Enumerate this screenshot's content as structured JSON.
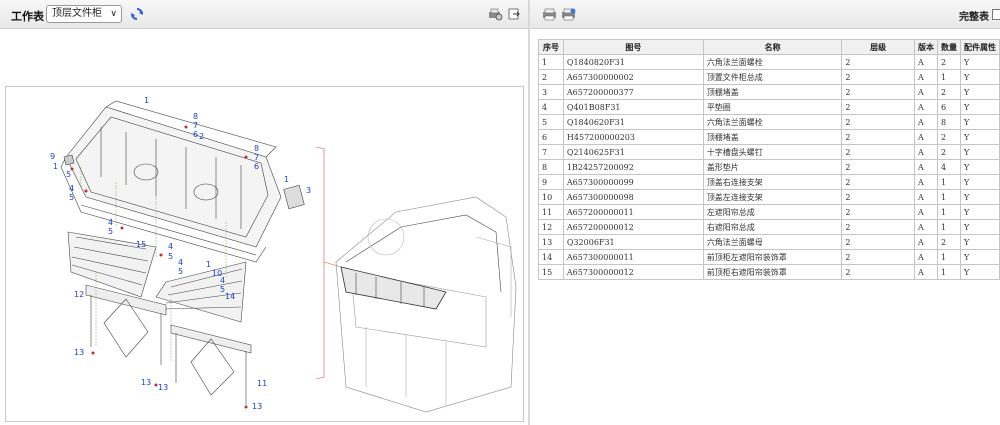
{
  "toolbar_left": {
    "title": "工作表",
    "select_value": "顶层文件柜",
    "icons": [
      "dropdown-chevron",
      "refresh-icon",
      "print-preview-icon",
      "export-icon"
    ]
  },
  "toolbar_right": {
    "complete_label": "完整表",
    "icons": [
      "print-icon",
      "print-all-icon"
    ],
    "complete_checked": false
  },
  "drawing": {
    "callouts": [
      "1",
      "8",
      "7",
      "6",
      "2",
      "9",
      "1",
      "5",
      "4",
      "5",
      "8",
      "7",
      "6",
      "1",
      "3",
      "4",
      "5",
      "4",
      "5",
      "15",
      "4",
      "5",
      "4",
      "5",
      "1",
      "10",
      "4",
      "5",
      "5",
      "12",
      "14",
      "13",
      "13",
      "13",
      "11",
      "13"
    ]
  },
  "table": {
    "headers": [
      "序号",
      "图号",
      "名称",
      "层级",
      "版本",
      "数量",
      "配件属性"
    ],
    "rows": [
      [
        "1",
        "Q1840820F31",
        "六角法兰面螺栓",
        "2",
        "A",
        "2",
        "Y"
      ],
      [
        "2",
        "A657300000002",
        "顶置文件柜总成",
        "2",
        "A",
        "1",
        "Y"
      ],
      [
        "3",
        "A657200000377",
        "顶棚堵盖",
        "2",
        "A",
        "2",
        "Y"
      ],
      [
        "4",
        "Q401B08F31",
        "平垫圈",
        "2",
        "A",
        "6",
        "Y"
      ],
      [
        "5",
        "Q1840620F31",
        "六角法兰面螺栓",
        "2",
        "A",
        "8",
        "Y"
      ],
      [
        "6",
        "H457200000203",
        "顶棚堵盖",
        "2",
        "A",
        "2",
        "Y"
      ],
      [
        "7",
        "Q2140625F31",
        "十字槽盘头螺钉",
        "2",
        "A",
        "2",
        "Y"
      ],
      [
        "8",
        "1B24257200092",
        "盖形垫片",
        "2",
        "A",
        "4",
        "Y"
      ],
      [
        "9",
        "A657300000099",
        "顶盖右连接支架",
        "2",
        "A",
        "1",
        "Y"
      ],
      [
        "10",
        "A657300000098",
        "顶盖左连接支架",
        "2",
        "A",
        "1",
        "Y"
      ],
      [
        "11",
        "A657200000011",
        "左遮阳帘总成",
        "2",
        "A",
        "1",
        "Y"
      ],
      [
        "12",
        "A657200000012",
        "右遮阳帘总成",
        "2",
        "A",
        "1",
        "Y"
      ],
      [
        "13",
        "Q32006F31",
        "六角法兰面螺母",
        "2",
        "A",
        "2",
        "Y"
      ],
      [
        "14",
        "A657300000011",
        "前顶柜左遮阳帘装饰罩",
        "2",
        "A",
        "1",
        "Y"
      ],
      [
        "15",
        "A657300000012",
        "前顶柜右遮阳帘装饰罩",
        "2",
        "A",
        "1",
        "Y"
      ]
    ]
  }
}
